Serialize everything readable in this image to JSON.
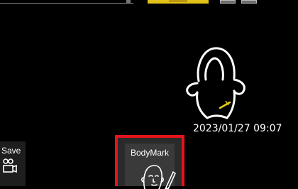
{
  "top_bar": {
    "field_icon": "search-field",
    "status_color": "#e4c21a",
    "buttons": [
      "button-a",
      "button-b"
    ]
  },
  "body_mark_display": {
    "icon": "head-neck-outline-icon",
    "probe_marker": "yellow-probe-marker",
    "timestamp": "2023/01/27 09:07"
  },
  "save_panel": {
    "label": "Save",
    "icon": "camera-icon"
  },
  "bodymark_button": {
    "label": "BodyMark",
    "icon": "face-pencil-icon",
    "highlight_color": "#e5131b"
  }
}
